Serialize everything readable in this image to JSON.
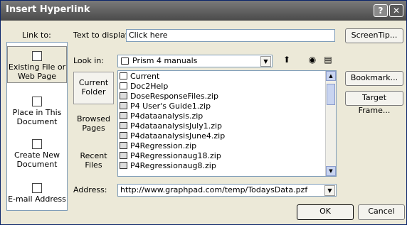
{
  "window": {
    "title": "Insert Hyperlink",
    "help_glyph": "?",
    "close_glyph": "✕"
  },
  "link_to": {
    "label": "Link to:",
    "items": [
      {
        "label": "Existing File or Web Page",
        "icon": "web-page-icon"
      },
      {
        "label": "Place in This Document",
        "icon": "document-place-icon"
      },
      {
        "label": "Create New Document",
        "icon": "new-document-icon"
      },
      {
        "label": "E-mail Address",
        "icon": "email-icon"
      }
    ]
  },
  "text_to_display": {
    "label": "Text to display:",
    "value": "Click here"
  },
  "screentip_button": "ScreenTip...",
  "look_in": {
    "label": "Look in:",
    "value": "Prism 4 manuals"
  },
  "side_tabs": [
    "Current Folder",
    "Browsed Pages",
    "Recent Files"
  ],
  "files": [
    {
      "name": "Current",
      "type": "folder"
    },
    {
      "name": "Doc2Help",
      "type": "folder"
    },
    {
      "name": "DoseResponseFiles.zip",
      "type": "zip"
    },
    {
      "name": "P4 User's Guide1.zip",
      "type": "zip"
    },
    {
      "name": "P4dataanalysis.zip",
      "type": "zip"
    },
    {
      "name": "P4dataanalysisJuly1.zip",
      "type": "zip"
    },
    {
      "name": "P4dataanalysisJune4.zip",
      "type": "zip"
    },
    {
      "name": "P4Regression.zip",
      "type": "zip"
    },
    {
      "name": "P4Regressionaug18.zip",
      "type": "zip"
    },
    {
      "name": "P4Regressionaug8.zip",
      "type": "zip"
    }
  ],
  "bookmark_button": "Bookmark...",
  "target_frame_button": "Target Frame...",
  "address": {
    "label": "Address:",
    "value": "http://www.graphpad.com/temp/TodaysData.pzf"
  },
  "ok_button": "OK",
  "cancel_button": "Cancel"
}
